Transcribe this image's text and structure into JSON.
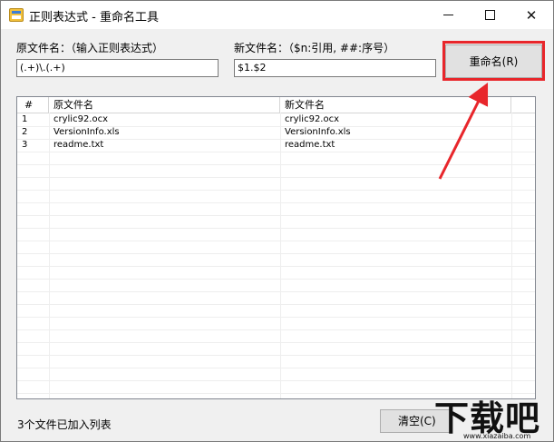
{
  "window": {
    "title": "正则表达式 - 重命名工具",
    "app_icon": "app-icon",
    "minimize_icon": "minimize-icon",
    "maximize_icon": "maximize-icon",
    "close_icon": "close-icon",
    "close_glyph": "✕"
  },
  "form": {
    "source_label": "原文件名：（输入正则表达式）",
    "source_value": "(.+)\\.(.+)",
    "target_label": "新文件名：（$n:引用, ##:序号）",
    "target_value": "$1.$2",
    "rename_button": "重命名(R)"
  },
  "list": {
    "columns": [
      "#",
      "原文件名",
      "新文件名"
    ],
    "rows": [
      {
        "num": "1",
        "original": "crylic92.ocx",
        "new": "crylic92.ocx"
      },
      {
        "num": "2",
        "original": "VersionInfo.xls",
        "new": "VersionInfo.xls"
      },
      {
        "num": "3",
        "original": "readme.txt",
        "new": "readme.txt"
      }
    ]
  },
  "status": {
    "text": "3个文件已加入列表",
    "clear_button": "清空(C)"
  },
  "watermark": {
    "main": "下载吧",
    "sub": "www.xiazaiba.com"
  },
  "colors": {
    "highlight": "#e8262b",
    "window_bg": "#f0f0f0",
    "button_bg": "#e1e1e1"
  }
}
